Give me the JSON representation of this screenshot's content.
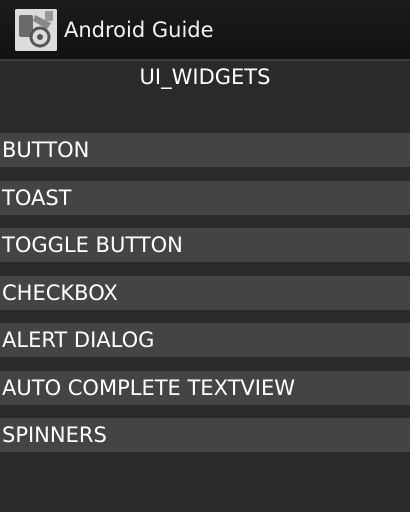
{
  "action_bar": {
    "title": "Android Guide",
    "icon": "app-logo-icon"
  },
  "header": {
    "title": "UI_WIDGETS"
  },
  "list": {
    "items": [
      {
        "label": "BUTTON"
      },
      {
        "label": "TOAST"
      },
      {
        "label": "TOGGLE BUTTON"
      },
      {
        "label": "CHECKBOX"
      },
      {
        "label": "ALERT DIALOG"
      },
      {
        "label": "AUTO COMPLETE TEXTVIEW"
      },
      {
        "label": "SPINNERS"
      }
    ]
  },
  "colors": {
    "background": "#2a2a2a",
    "row_band": "#444444",
    "action_bar": "#161616",
    "text": "#ffffff"
  }
}
